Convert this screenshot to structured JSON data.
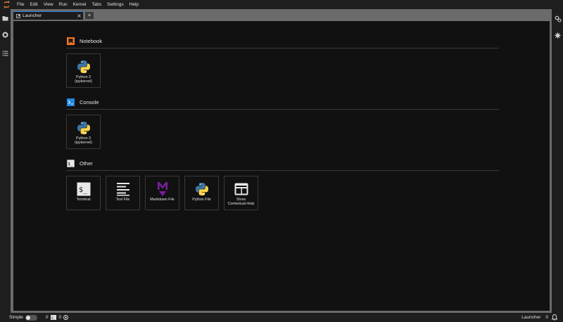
{
  "menubar": {
    "items": [
      "File",
      "Edit",
      "View",
      "Run",
      "Kernel",
      "Tabs",
      "Settings",
      "Help"
    ]
  },
  "leftbar": {
    "icons": [
      "folder-icon",
      "running-icon",
      "toc-icon"
    ]
  },
  "rightbar": {
    "icons": [
      "property-inspector-icon",
      "debugger-icon"
    ]
  },
  "tabs": [
    {
      "label": "Launcher",
      "active": true
    }
  ],
  "new_tab_label": "+",
  "launcher": {
    "sections": [
      {
        "title": "Notebook",
        "cards": [
          {
            "label": "Python 3",
            "sublabel": "(ipykernel)",
            "icon": "python-logo"
          }
        ]
      },
      {
        "title": "Console",
        "cards": [
          {
            "label": "Python 3",
            "sublabel": "(ipykernel)",
            "icon": "python-logo"
          }
        ]
      },
      {
        "title": "Other",
        "cards": [
          {
            "label": "Terminal",
            "sublabel": "",
            "icon": "terminal-icon"
          },
          {
            "label": "Text File",
            "sublabel": "",
            "icon": "text-file-icon"
          },
          {
            "label": "Markdown File",
            "sublabel": "",
            "icon": "markdown-icon"
          },
          {
            "label": "Python File",
            "sublabel": "",
            "icon": "python-logo"
          },
          {
            "label": "Show",
            "sublabel": "Contextual Help",
            "icon": "contextual-help-icon"
          }
        ]
      }
    ]
  },
  "statusbar": {
    "mode_label": "Simple",
    "kernels_count": "0",
    "terminals_count": "0",
    "current_activity": "Launcher",
    "notifications_count": "0"
  },
  "colors": {
    "accent": "#2f7ad6",
    "notebook_orange": "#f37726",
    "console_blue": "#1e88e5",
    "markdown_purple": "#7b1fa2",
    "python_blue": "#3b77a8",
    "python_yellow": "#f8d34c"
  }
}
